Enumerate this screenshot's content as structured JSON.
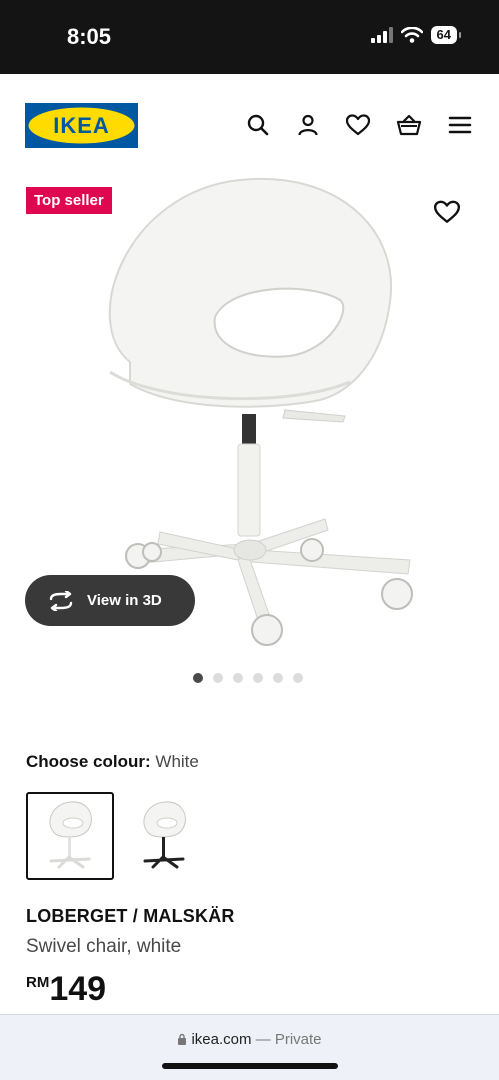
{
  "status_bar": {
    "time": "8:05",
    "battery": "64",
    "icons": [
      "cellular-signal-icon",
      "wifi-icon",
      "battery-icon"
    ]
  },
  "header": {
    "logo_text": "IKEA",
    "icons": [
      "search-icon",
      "account-icon",
      "heart-icon",
      "basket-icon",
      "menu-icon"
    ],
    "brand_colors": {
      "blue": "#0058a3",
      "yellow": "#ffdb00"
    }
  },
  "product_gallery": {
    "badge": "Top seller",
    "badge_color": "#e00751",
    "view_3d_label": "View in 3D",
    "image_count": 6,
    "active_image": 1
  },
  "colour": {
    "label": "Choose colour:",
    "value": "White",
    "options": [
      "White",
      "Black"
    ]
  },
  "product": {
    "name": "LOBERGET / MALSKÄR",
    "description": "Swivel chair, white",
    "currency": "RM",
    "price": "149"
  },
  "browser": {
    "domain": "ikea.com",
    "separator": " — ",
    "mode": "Private"
  }
}
